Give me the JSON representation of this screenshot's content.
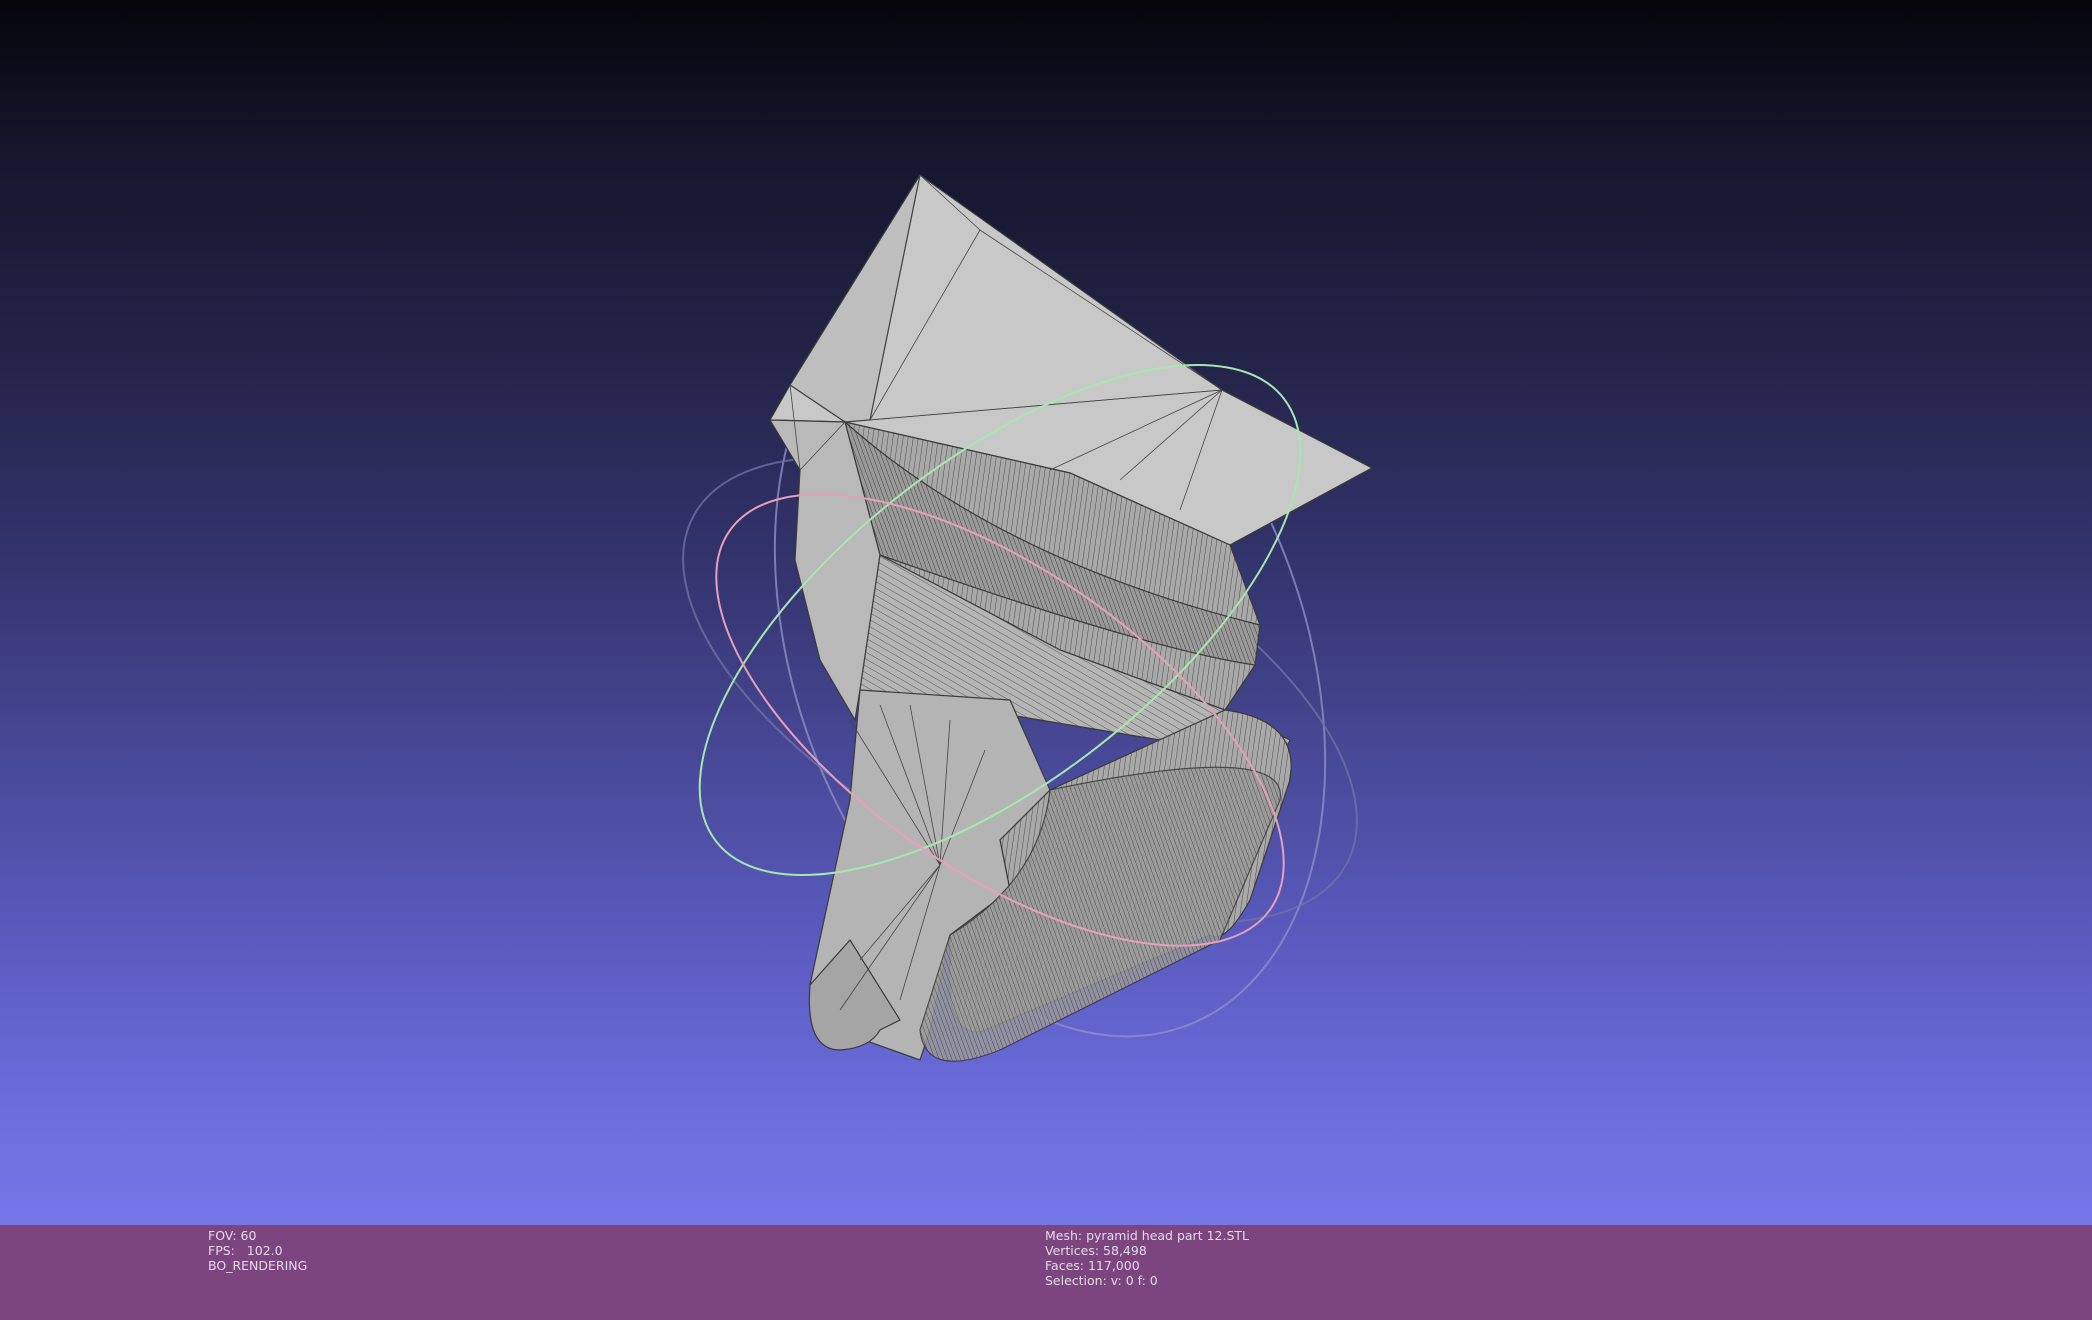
{
  "render_info": {
    "fov": "FOV: 60",
    "fps": "FPS:   102.0",
    "mode": "BO_RENDERING"
  },
  "mesh_info": {
    "mesh": "Mesh: pyramid head part 12.STL",
    "vertices": "Vertices: 58,498",
    "faces": "Faces: 117,000",
    "selection": "Selection: v: 0 f: 0"
  },
  "colors": {
    "status_bar": "#7d4580",
    "mesh_face": "#bcbcbc",
    "trackball_x": "#e6a0b8",
    "trackball_y": "#a8e6b0",
    "trackball_z": "#b0b0e8"
  },
  "icons": {
    "trackball": "trackball-gizmo"
  }
}
